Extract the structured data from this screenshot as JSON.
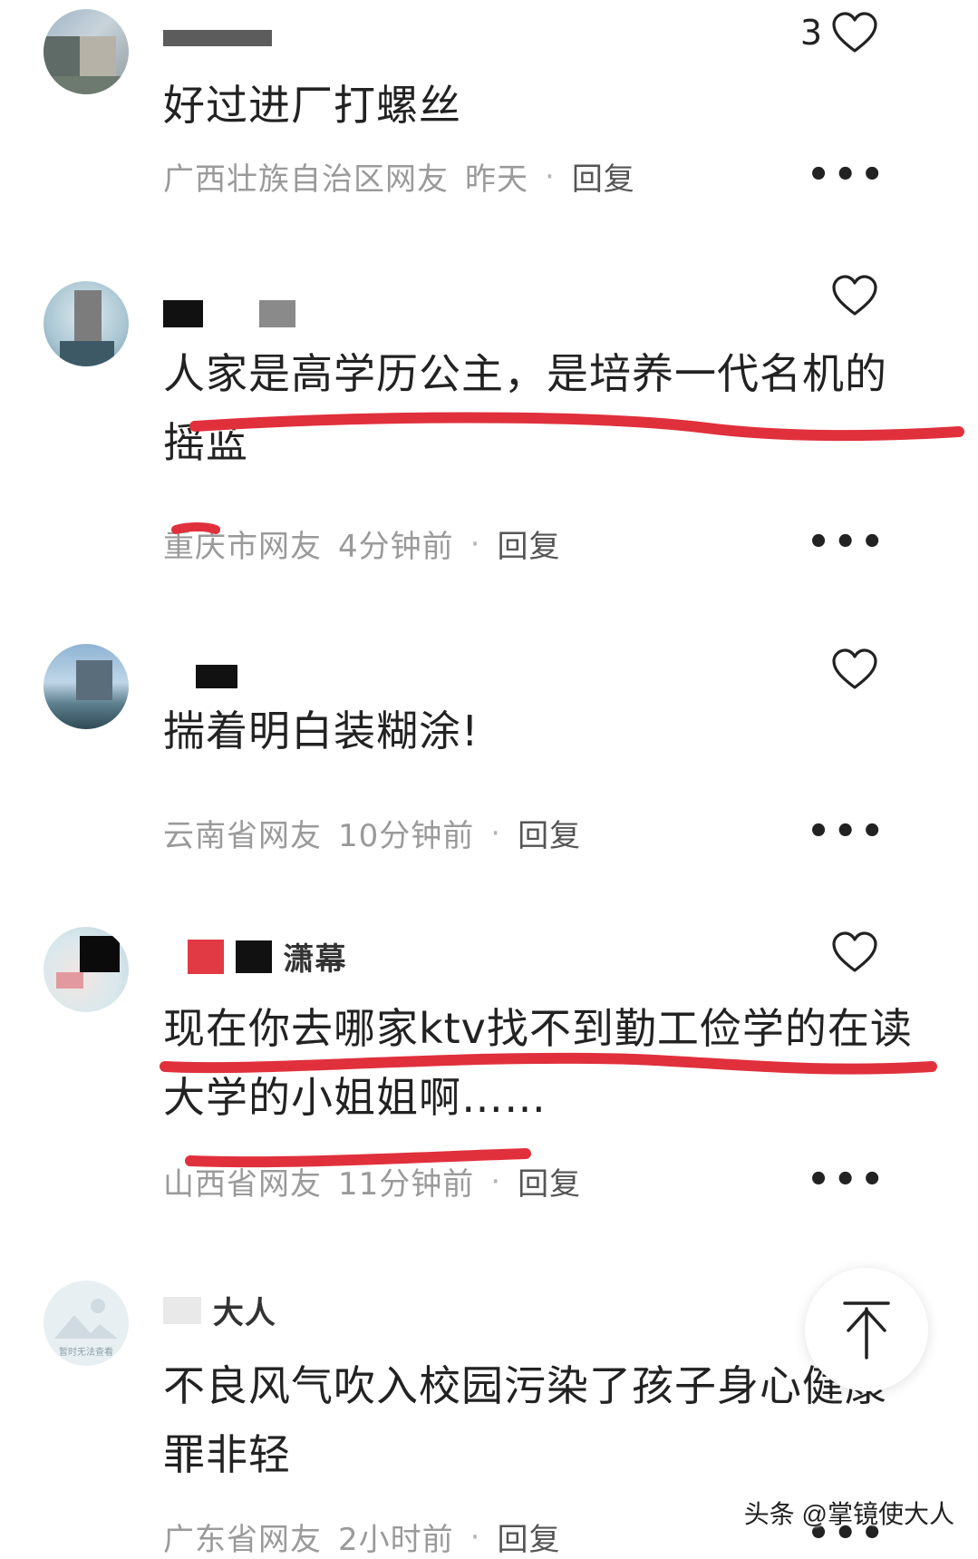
{
  "comments": [
    {
      "text": "好过进厂打螺丝",
      "likes": "3",
      "location": "广西壮族自治区网友",
      "time": "昨天",
      "reply": "回复"
    },
    {
      "text": "人家是高学历公主，是培养一代名机的摇蓝",
      "location": "重庆市网友",
      "time": "4分钟前",
      "reply": "回复"
    },
    {
      "text": "揣着明白装糊涂!",
      "location": "云南省网友",
      "time": "10分钟前",
      "reply": "回复"
    },
    {
      "name_visible": "潇幕",
      "text": "现在你去哪家ktv找不到勤工俭学的在读大学的小姐姐啊……",
      "location": "山西省网友",
      "time": "11分钟前",
      "reply": "回复"
    },
    {
      "name_visible": "大人",
      "avatar_text": "暂时无法查看",
      "text": "不良风气吹入校园污染了孩子身心健康罪非轻",
      "location": "广东省网友",
      "time": "2小时前",
      "reply": "回复"
    }
  ],
  "more_label": "•••",
  "watermark": "头条 @掌镜使大人",
  "icons": {
    "like": "heart-outline-icon",
    "more": "more-dots-icon",
    "scroll_top": "arrow-up-icon"
  },
  "colors": {
    "underline": "#e0303c",
    "meta": "#9a9a9a"
  }
}
